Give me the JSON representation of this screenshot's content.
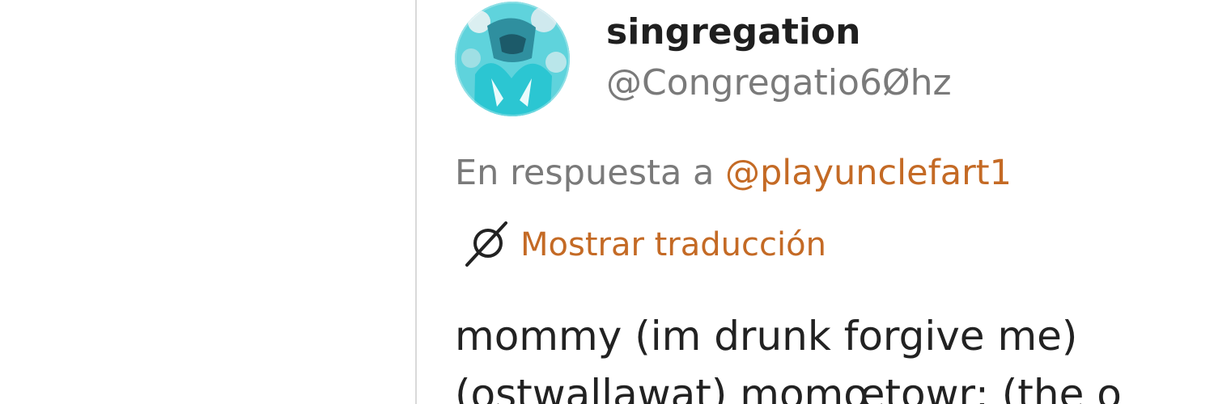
{
  "tweet": {
    "author": {
      "display_name": "singregation",
      "handle": "@Congregatio6Øhz",
      "avatar_icon": "avatar-image"
    },
    "reply": {
      "prefix": "En respuesta a",
      "mention": "@playunclefart1"
    },
    "translate": {
      "icon": "translate-icon",
      "label": "Mostrar traducción"
    },
    "body_lines": [
      "mommy (im drunk forgive me)",
      "(ostwallawat) momœtowr; (the o"
    ]
  },
  "colors": {
    "accent": "#c46a25",
    "secondary_text": "#7a7a7a",
    "primary_text": "#222222",
    "divider": "#d9d9d9"
  }
}
